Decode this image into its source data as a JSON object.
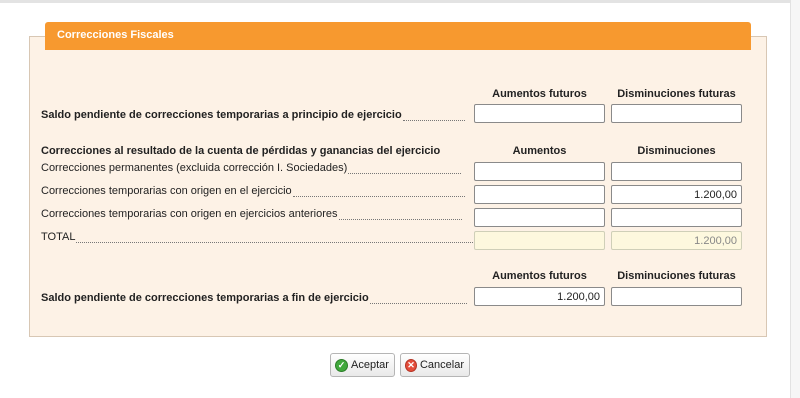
{
  "panel": {
    "title": "Correcciones Fiscales"
  },
  "section1": {
    "header_aumentos": "Aumentos futuros",
    "header_disminuciones": "Disminuciones futuras",
    "label": "Saldo pendiente de correcciones temporarias a principio de ejercicio",
    "aumentos_value": "",
    "disminuciones_value": ""
  },
  "section2": {
    "title": "Correcciones al resultado de la cuenta de pérdidas y ganancias del ejercicio",
    "header_aumentos": "Aumentos",
    "header_disminuciones": "Disminuciones",
    "rows": [
      {
        "label": "Correcciones permanentes (excluida corrección I. Sociedades)",
        "aumentos": "",
        "disminuciones": ""
      },
      {
        "label": "Correcciones temporarias con origen en el ejercicio",
        "aumentos": "",
        "disminuciones": "1.200,00"
      },
      {
        "label": "Correcciones temporarias con origen en ejercicios anteriores",
        "aumentos": "",
        "disminuciones": ""
      },
      {
        "label": "TOTAL",
        "aumentos": "",
        "disminuciones": "1.200,00"
      }
    ]
  },
  "section3": {
    "header_aumentos": "Aumentos futuros",
    "header_disminuciones": "Disminuciones futuras",
    "label": "Saldo pendiente de correcciones temporarias a fin de ejercicio",
    "aumentos_value": "1.200,00",
    "disminuciones_value": ""
  },
  "buttons": {
    "accept": "Aceptar",
    "cancel": "Cancelar"
  },
  "icons": {
    "accept": "check-circle-icon",
    "cancel": "close-circle-icon"
  },
  "colors": {
    "title_bar": "#f7992f",
    "panel_bg": "#fdf2e6",
    "readonly_bg": "#fdf8de"
  }
}
